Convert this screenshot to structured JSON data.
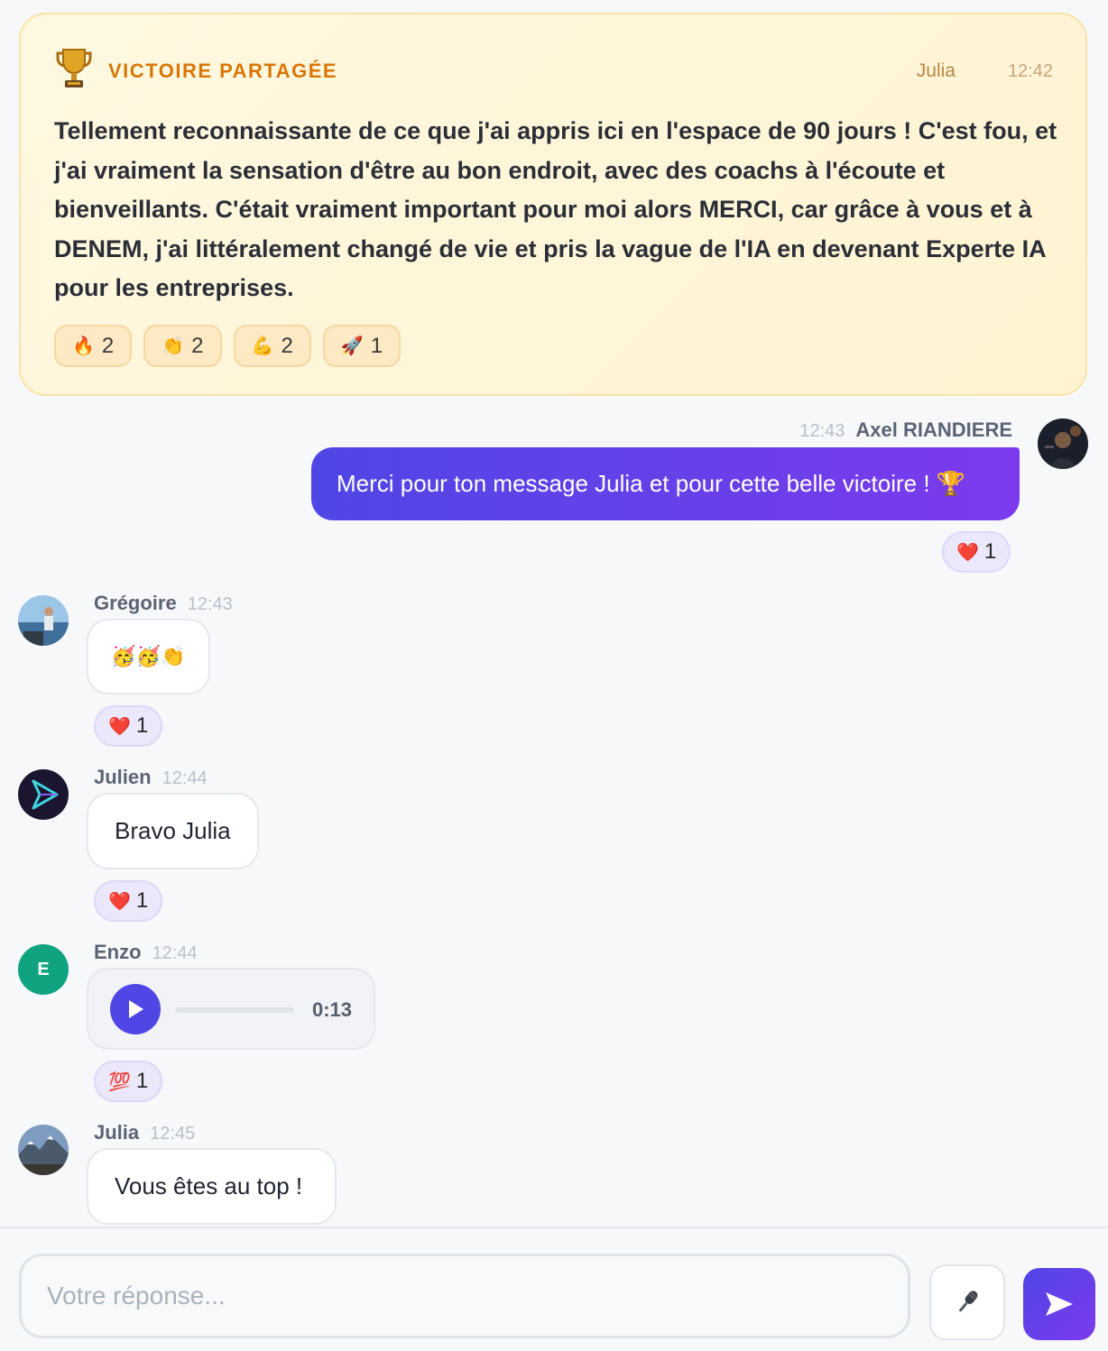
{
  "victory": {
    "title": "VICTOIRE PARTAGÉE",
    "author": "Julia",
    "time": "12:42",
    "text": "Tellement reconnaissante de ce que j'ai appris ici en l'espace de 90 jours ! C'est fou, et j'ai vraiment la sensation d'être au bon endroit, avec des coachs à l'écoute et bienveillants. C'était vraiment important pour moi alors MERCI, car grâce à vous et à DENEM, j'ai littéralement changé de vie et pris la vague de l'IA en devenant Experte IA pour les entreprises.",
    "reactions": [
      {
        "emoji": "🔥",
        "count": "2"
      },
      {
        "emoji": "👏",
        "count": "2"
      },
      {
        "emoji": "💪",
        "count": "2"
      },
      {
        "emoji": "🚀",
        "count": "1"
      }
    ]
  },
  "messages": [
    {
      "author": "Axel RIANDIERE",
      "time": "12:43",
      "text": "Merci pour ton message Julia et pour cette belle victoire ! 🏆",
      "reaction": {
        "emoji": "❤️",
        "count": "1"
      }
    },
    {
      "author": "Grégoire",
      "time": "12:43",
      "text": "🥳🥳👏",
      "reaction": {
        "emoji": "❤️",
        "count": "1"
      }
    },
    {
      "author": "Julien",
      "time": "12:44",
      "text": "Bravo Julia",
      "reaction": {
        "emoji": "❤️",
        "count": "1"
      }
    },
    {
      "author": "Enzo",
      "time": "12:44",
      "avatar_initial": "E",
      "audio_duration": "0:13",
      "reaction": {
        "emoji": "💯",
        "count": "1"
      }
    },
    {
      "author": "Julia",
      "time": "12:45",
      "text": "Vous êtes au top !"
    }
  ],
  "composer": {
    "placeholder": "Votre réponse...",
    "mic_icon": "microphone-icon",
    "send_icon": "send-icon"
  },
  "colors": {
    "accent": "#4f46e5",
    "accent_end": "#7c3aed",
    "victory_title": "#d97706",
    "enzo_avatar": "#10a37f"
  }
}
